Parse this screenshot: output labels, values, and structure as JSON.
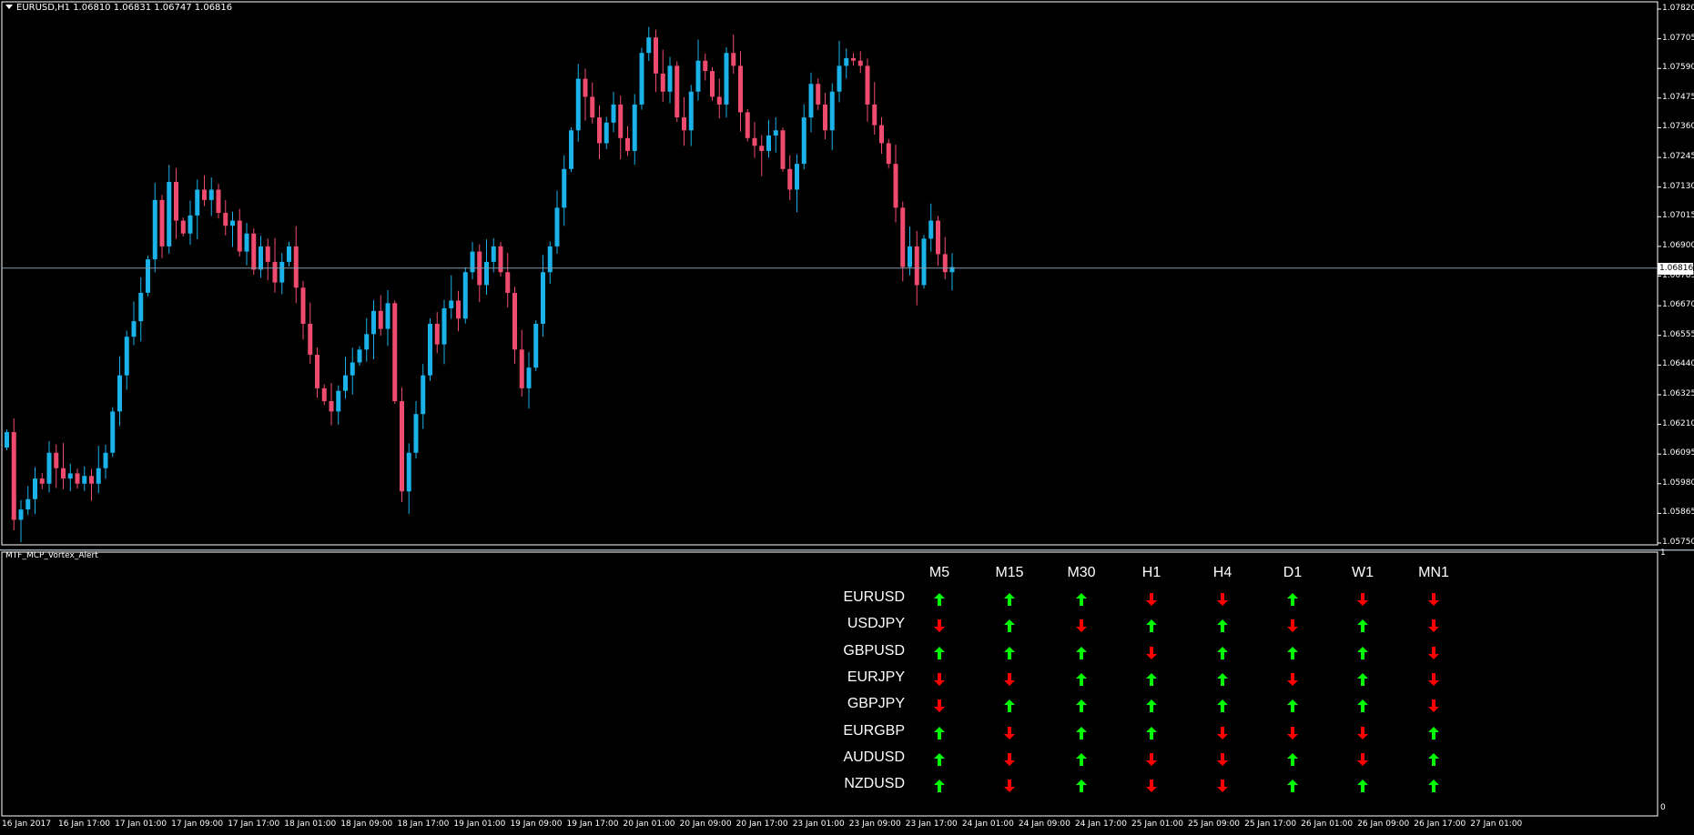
{
  "chart_data": {
    "type": "candlestick",
    "symbol_header": "EURUSD,H1  1.06810 1.06831 1.06747 1.06816",
    "current_price": "1.06816",
    "y_ticks": [
      "1.07820",
      "1.07705",
      "1.07590",
      "1.07475",
      "1.07360",
      "1.07245",
      "1.07130",
      "1.07015",
      "1.06900",
      "1.06785",
      "1.06670",
      "1.06555",
      "1.06440",
      "1.06325",
      "1.06210",
      "1.06095",
      "1.05980",
      "1.05865",
      "1.05750"
    ],
    "ylim": [
      1.0575,
      1.0782
    ],
    "x_ticks": [
      "16 Jan 2017",
      "16 Jan 17:00",
      "17 Jan 01:00",
      "17 Jan 09:00",
      "17 Jan 17:00",
      "18 Jan 01:00",
      "18 Jan 09:00",
      "18 Jan 17:00",
      "19 Jan 01:00",
      "19 Jan 09:00",
      "19 Jan 17:00",
      "20 Jan 01:00",
      "20 Jan 09:00",
      "20 Jan 17:00",
      "23 Jan 01:00",
      "23 Jan 09:00",
      "23 Jan 17:00",
      "24 Jan 01:00",
      "24 Jan 09:00",
      "24 Jan 17:00",
      "25 Jan 01:00",
      "25 Jan 09:00",
      "25 Jan 17:00",
      "26 Jan 01:00",
      "26 Jan 09:00",
      "26 Jan 17:00",
      "27 Jan 01:00"
    ],
    "colors": {
      "bull": "#1ab2e8",
      "bear": "#ef4b6e",
      "grid": "#ffffff",
      "price_line": "#8a9bb0"
    },
    "closes": [
      1.0618,
      1.0584,
      1.0588,
      1.0592,
      1.06,
      1.0598,
      1.061,
      1.0604,
      1.06,
      1.0602,
      1.0598,
      1.0601,
      1.0598,
      1.0604,
      1.061,
      1.0626,
      1.064,
      1.0655,
      1.0661,
      1.0672,
      1.0685,
      1.0708,
      1.069,
      1.0715,
      1.07,
      1.0695,
      1.0702,
      1.0712,
      1.0708,
      1.0712,
      1.0703,
      1.0698,
      1.07,
      1.0688,
      1.0695,
      1.0681,
      1.069,
      1.0684,
      1.0676,
      1.0684,
      1.069,
      1.0674,
      1.066,
      1.0648,
      1.0635,
      1.063,
      1.0626,
      1.0634,
      1.064,
      1.0645,
      1.065,
      1.0656,
      1.0665,
      1.0658,
      1.0668,
      1.063,
      1.0595,
      1.061,
      1.0625,
      1.064,
      1.066,
      1.0652,
      1.0666,
      1.0669,
      1.0662,
      1.068,
      1.0688,
      1.0675,
      1.0684,
      1.069,
      1.068,
      1.0672,
      1.065,
      1.0635,
      1.0643,
      1.066,
      1.068,
      1.069,
      1.0705,
      1.072,
      1.0735,
      1.0755,
      1.0748,
      1.074,
      1.073,
      1.0738,
      1.0745,
      1.0732,
      1.0727,
      1.0745,
      1.0765,
      1.0771,
      1.0757,
      1.075,
      1.076,
      1.074,
      1.0735,
      1.075,
      1.0762,
      1.0758,
      1.0748,
      1.0745,
      1.0765,
      1.076,
      1.0742,
      1.0732,
      1.0729,
      1.0727,
      1.0733,
      1.0735,
      1.072,
      1.0712,
      1.0722,
      1.074,
      1.0753,
      1.0745,
      1.0735,
      1.075,
      1.076,
      1.0763,
      1.0762,
      1.076,
      1.0745,
      1.0737,
      1.073,
      1.0722,
      1.0705,
      1.0682,
      1.069,
      1.0675,
      1.0693,
      1.07,
      1.0687,
      1.068,
      1.0682
    ]
  },
  "indicator": {
    "title": "MTF_MCP_Vortex_Alert",
    "scale_top": "1",
    "scale_bottom": "0",
    "timeframes": [
      "M5",
      "M15",
      "M30",
      "H1",
      "H4",
      "D1",
      "W1",
      "MN1"
    ],
    "colors": {
      "up": "#00ff00",
      "down": "#ff0000"
    },
    "rows": [
      {
        "symbol": "EURUSD",
        "signals": [
          "up",
          "up",
          "up",
          "down",
          "down",
          "up",
          "down",
          "down"
        ]
      },
      {
        "symbol": "USDJPY",
        "signals": [
          "down",
          "up",
          "down",
          "up",
          "up",
          "down",
          "up",
          "down"
        ]
      },
      {
        "symbol": "GBPUSD",
        "signals": [
          "up",
          "up",
          "up",
          "down",
          "up",
          "up",
          "up",
          "down"
        ]
      },
      {
        "symbol": "EURJPY",
        "signals": [
          "down",
          "down",
          "up",
          "up",
          "up",
          "down",
          "up",
          "down"
        ]
      },
      {
        "symbol": "GBPJPY",
        "signals": [
          "down",
          "up",
          "up",
          "up",
          "up",
          "up",
          "up",
          "down"
        ]
      },
      {
        "symbol": "EURGBP",
        "signals": [
          "up",
          "down",
          "up",
          "up",
          "down",
          "down",
          "down",
          "up"
        ]
      },
      {
        "symbol": "AUDUSD",
        "signals": [
          "up",
          "down",
          "up",
          "down",
          "down",
          "up",
          "down",
          "up"
        ]
      },
      {
        "symbol": "NZDUSD",
        "signals": [
          "up",
          "down",
          "up",
          "down",
          "down",
          "up",
          "up",
          "up"
        ]
      }
    ]
  }
}
